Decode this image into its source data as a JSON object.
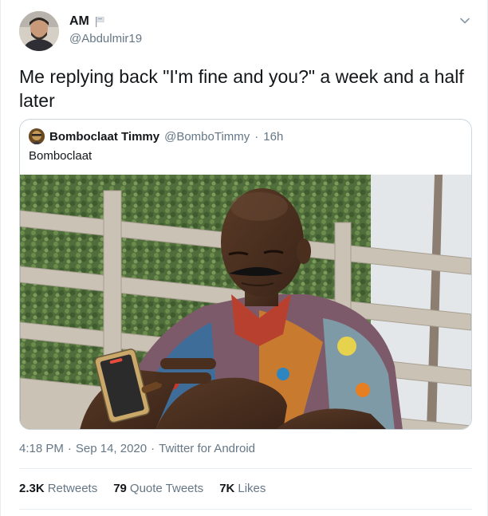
{
  "author": {
    "display_name": "AM",
    "handle": "@Abdulmir19",
    "avatar_icon": "profile-photo"
  },
  "tweet": {
    "text": "Me replying back \"I'm fine and you?\" a week and a half later"
  },
  "quoted": {
    "display_name": "Bomboclaat Timmy",
    "handle": "@BomboTimmy",
    "separator": "·",
    "time": "16h",
    "text": "Bomboclaat",
    "media_icon": "photo-man-looking-at-phone"
  },
  "meta": {
    "time": "4:18 PM",
    "sep1": "·",
    "date": "Sep 14, 2020",
    "sep2": "·",
    "source": "Twitter for Android"
  },
  "stats": [
    {
      "count": "2.3K",
      "label": "Retweets"
    },
    {
      "count": "79",
      "label": "Quote Tweets"
    },
    {
      "count": "7K",
      "label": "Likes"
    }
  ],
  "colors": {
    "primary_text": "#14171a",
    "secondary_text": "#657786",
    "border": "#ccd6dd",
    "divider": "#e6ecf0"
  }
}
